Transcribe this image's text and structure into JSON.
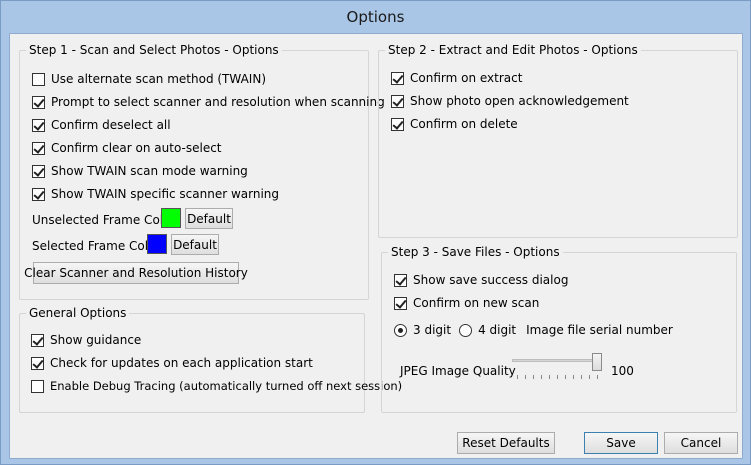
{
  "window": {
    "title": "Options"
  },
  "step1": {
    "legend": "Step 1 - Scan and Select Photos - Options",
    "options": [
      {
        "label": "Use alternate scan method (TWAIN)",
        "checked": false
      },
      {
        "label": "Prompt to select scanner and resolution when scanning",
        "checked": true
      },
      {
        "label": "Confirm deselect all",
        "checked": true
      },
      {
        "label": "Confirm clear on auto-select",
        "checked": true
      },
      {
        "label": "Show TWAIN scan mode warning",
        "checked": true
      },
      {
        "label": "Show TWAIN specific scanner warning",
        "checked": true
      }
    ],
    "unselected_frame_label": "Unselected Frame Color",
    "unselected_frame_color": "#00ff00",
    "selected_frame_label": "Selected Frame Color",
    "selected_frame_color": "#0000ff",
    "default_label": "Default",
    "clear_history_label": "Clear Scanner and Resolution History"
  },
  "step2": {
    "legend": "Step 2 - Extract and Edit Photos - Options",
    "options": [
      {
        "label": "Confirm on extract",
        "checked": true
      },
      {
        "label": "Show photo open acknowledgement",
        "checked": true
      },
      {
        "label": "Confirm on delete",
        "checked": true
      }
    ]
  },
  "general": {
    "legend": "General Options",
    "options": [
      {
        "label": "Show guidance",
        "checked": true
      },
      {
        "label": "Check for updates on each application start",
        "checked": true
      },
      {
        "label": "Enable Debug Tracing (automatically turned off next session)",
        "checked": false
      }
    ]
  },
  "step3": {
    "legend": "Step 3 - Save Files - Options",
    "options": [
      {
        "label": "Show save success dialog",
        "checked": true
      },
      {
        "label": "Confirm on new scan",
        "checked": true
      }
    ],
    "radio_3digit": "3 digit",
    "radio_4digit": "4 digit",
    "selected_digits": "3 digit",
    "serial_label": "Image file serial number",
    "jpeg_label": "JPEG Image Quality",
    "jpeg_value": "100",
    "jpeg_fraction": 1.0
  },
  "buttons": {
    "reset": "Reset Defaults",
    "save": "Save",
    "cancel": "Cancel"
  }
}
